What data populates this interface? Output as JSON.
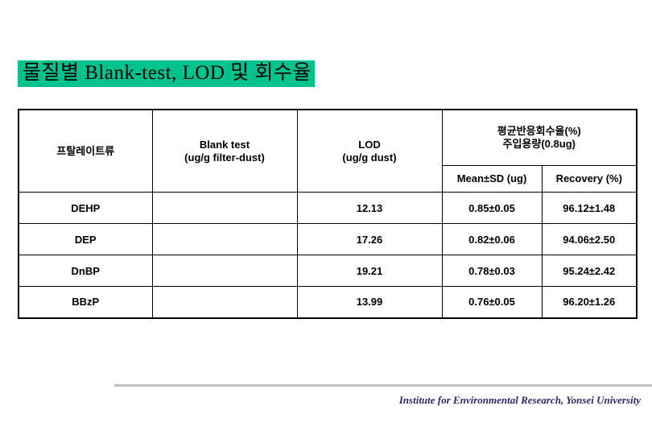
{
  "slide": {
    "title": "물질별 Blank-test, LOD 및 회수율",
    "title_highlight_color": "#00c28c"
  },
  "table": {
    "headers": {
      "substance": "프탈레이트류",
      "blank_test": "Blank test\n(ug/g filter-dust)",
      "lod": "LOD\n(ug/g dust)",
      "recovery_group": "평균반응회수율(%)\n주입용량(0.8ug)",
      "mean_sd": "Mean±SD (ug)",
      "recovery": "Recovery (%)"
    },
    "rows": [
      {
        "substance": "DEHP",
        "blank_test": "",
        "lod": "12.13",
        "mean_sd": "0.85±0.05",
        "recovery": "96.12±1.48"
      },
      {
        "substance": "DEP",
        "blank_test": "",
        "lod": "17.26",
        "mean_sd": "0.82±0.06",
        "recovery": "94.06±2.50"
      },
      {
        "substance": "DnBP",
        "blank_test": "",
        "lod": "19.21",
        "mean_sd": "0.78±0.03",
        "recovery": "95.24±2.42"
      },
      {
        "substance": "BBzP",
        "blank_test": "",
        "lod": "13.99",
        "mean_sd": "0.76±0.05",
        "recovery": "96.20±1.26"
      }
    ]
  },
  "footer": {
    "text": "Institute for Environmental Research, Yonsei University",
    "color": "#2a2a6a",
    "rule_color": "#bfbfbf"
  }
}
